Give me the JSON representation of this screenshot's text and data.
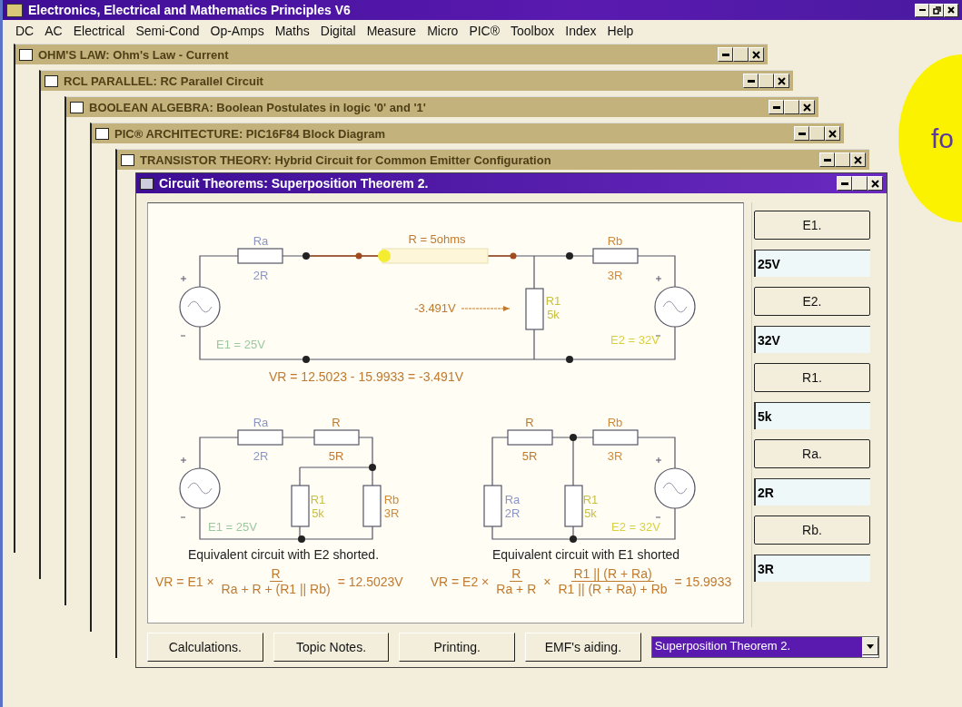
{
  "window": {
    "title": "Electronics, Electrical and Mathematics Principles V6"
  },
  "menu": [
    "DC",
    "AC",
    "Electrical",
    "Semi-Cond",
    "Op-Amps",
    "Maths",
    "Digital",
    "Measure",
    "Micro",
    "PIC®",
    "Toolbox",
    "Index",
    "Help"
  ],
  "background_windows": [
    {
      "title": "OHM'S LAW:  Ohm's Law - Current"
    },
    {
      "title": "RCL PARALLEL:  RC Parallel Circuit"
    },
    {
      "title": "BOOLEAN ALGEBRA:  Boolean Postulates in logic '0' and '1'"
    },
    {
      "title": "PIC® ARCHITECTURE:  PIC16F84 Block Diagram"
    },
    {
      "title": "TRANSISTOR THEORY:  Hybrid Circuit for Common Emitter Configuration"
    }
  ],
  "active_window": {
    "title": "Circuit Theorems:  Superposition Theorem 2.",
    "main_circuit": {
      "labels": [
        {
          "text": "Ra",
          "color": "#8a96c8"
        },
        {
          "text": "2R",
          "color": "#8a96c8"
        },
        {
          "text": "R = 5ohms",
          "color": "#c07a30"
        },
        {
          "text": "Rb",
          "color": "#d08a3a"
        },
        {
          "text": "3R",
          "color": "#d08a3a"
        },
        {
          "text": "R1",
          "color": "#c8c040"
        },
        {
          "text": "5k",
          "color": "#c8c040"
        },
        {
          "text": "-3.491V",
          "color": "#c07a30"
        },
        {
          "text": "E1 = 25V",
          "color": "#9cc8a0"
        },
        {
          "text": "E2 = 32V",
          "color": "#d8d040"
        }
      ],
      "result": "VR = 12.5023 - 15.9933 = -3.491V"
    },
    "sub_circuits": [
      {
        "labels": [
          {
            "text": "Ra",
            "color": "#8a96c8"
          },
          {
            "text": "2R",
            "color": "#8a96c8"
          },
          {
            "text": "R",
            "color": "#c07a30"
          },
          {
            "text": "5R",
            "color": "#c07a30"
          },
          {
            "text": "R1",
            "color": "#c8c040"
          },
          {
            "text": "5k",
            "color": "#c8c040"
          },
          {
            "text": "Rb",
            "color": "#d08a3a"
          },
          {
            "text": "3R",
            "color": "#d08a3a"
          },
          {
            "text": "E1 = 25V",
            "color": "#9cc8a0"
          }
        ],
        "caption": "Equivalent circuit with E2 shorted."
      },
      {
        "labels": [
          {
            "text": "R",
            "color": "#c07a30"
          },
          {
            "text": "5R",
            "color": "#c07a30"
          },
          {
            "text": "Rb",
            "color": "#d08a3a"
          },
          {
            "text": "3R",
            "color": "#d08a3a"
          },
          {
            "text": "Ra",
            "color": "#8a96c8"
          },
          {
            "text": "2R",
            "color": "#8a96c8"
          },
          {
            "text": "R1",
            "color": "#c8c040"
          },
          {
            "text": "5k",
            "color": "#c8c040"
          },
          {
            "text": "E2 = 32V",
            "color": "#d8d040"
          }
        ],
        "caption": "Equivalent circuit with E1 shorted"
      }
    ],
    "formulas": [
      {
        "terms": [
          {
            "kind": "text",
            "text": "VR = E1 ×"
          },
          {
            "kind": "fraction",
            "num": "R",
            "den": "Ra + R + (R1 || Rb)"
          },
          {
            "kind": "text",
            "text": "= 12.5023V"
          }
        ]
      },
      {
        "terms": [
          {
            "kind": "text",
            "text": "VR = E2 ×"
          },
          {
            "kind": "fraction",
            "num": "R",
            "den": "Ra + R"
          },
          {
            "kind": "text",
            "text": "×"
          },
          {
            "kind": "fraction",
            "num": "R1 || (R + Ra)",
            "den": "R1 || (R + Ra) + Rb"
          },
          {
            "kind": "text",
            "text": "= 15.9933"
          }
        ]
      }
    ],
    "inputs": [
      {
        "button": "E1.",
        "value": "25V"
      },
      {
        "button": "E2.",
        "value": "32V"
      },
      {
        "button": "R1.",
        "value": "5k"
      },
      {
        "button": "Ra.",
        "value": "2R"
      },
      {
        "button": "Rb.",
        "value": "3R"
      }
    ],
    "buttons": [
      "Calculations.",
      "Topic Notes.",
      "Printing.",
      "EMF's aiding."
    ],
    "topic_select": {
      "value": "Superposition Theorem 2."
    }
  },
  "promo": {
    "text": "fo"
  }
}
